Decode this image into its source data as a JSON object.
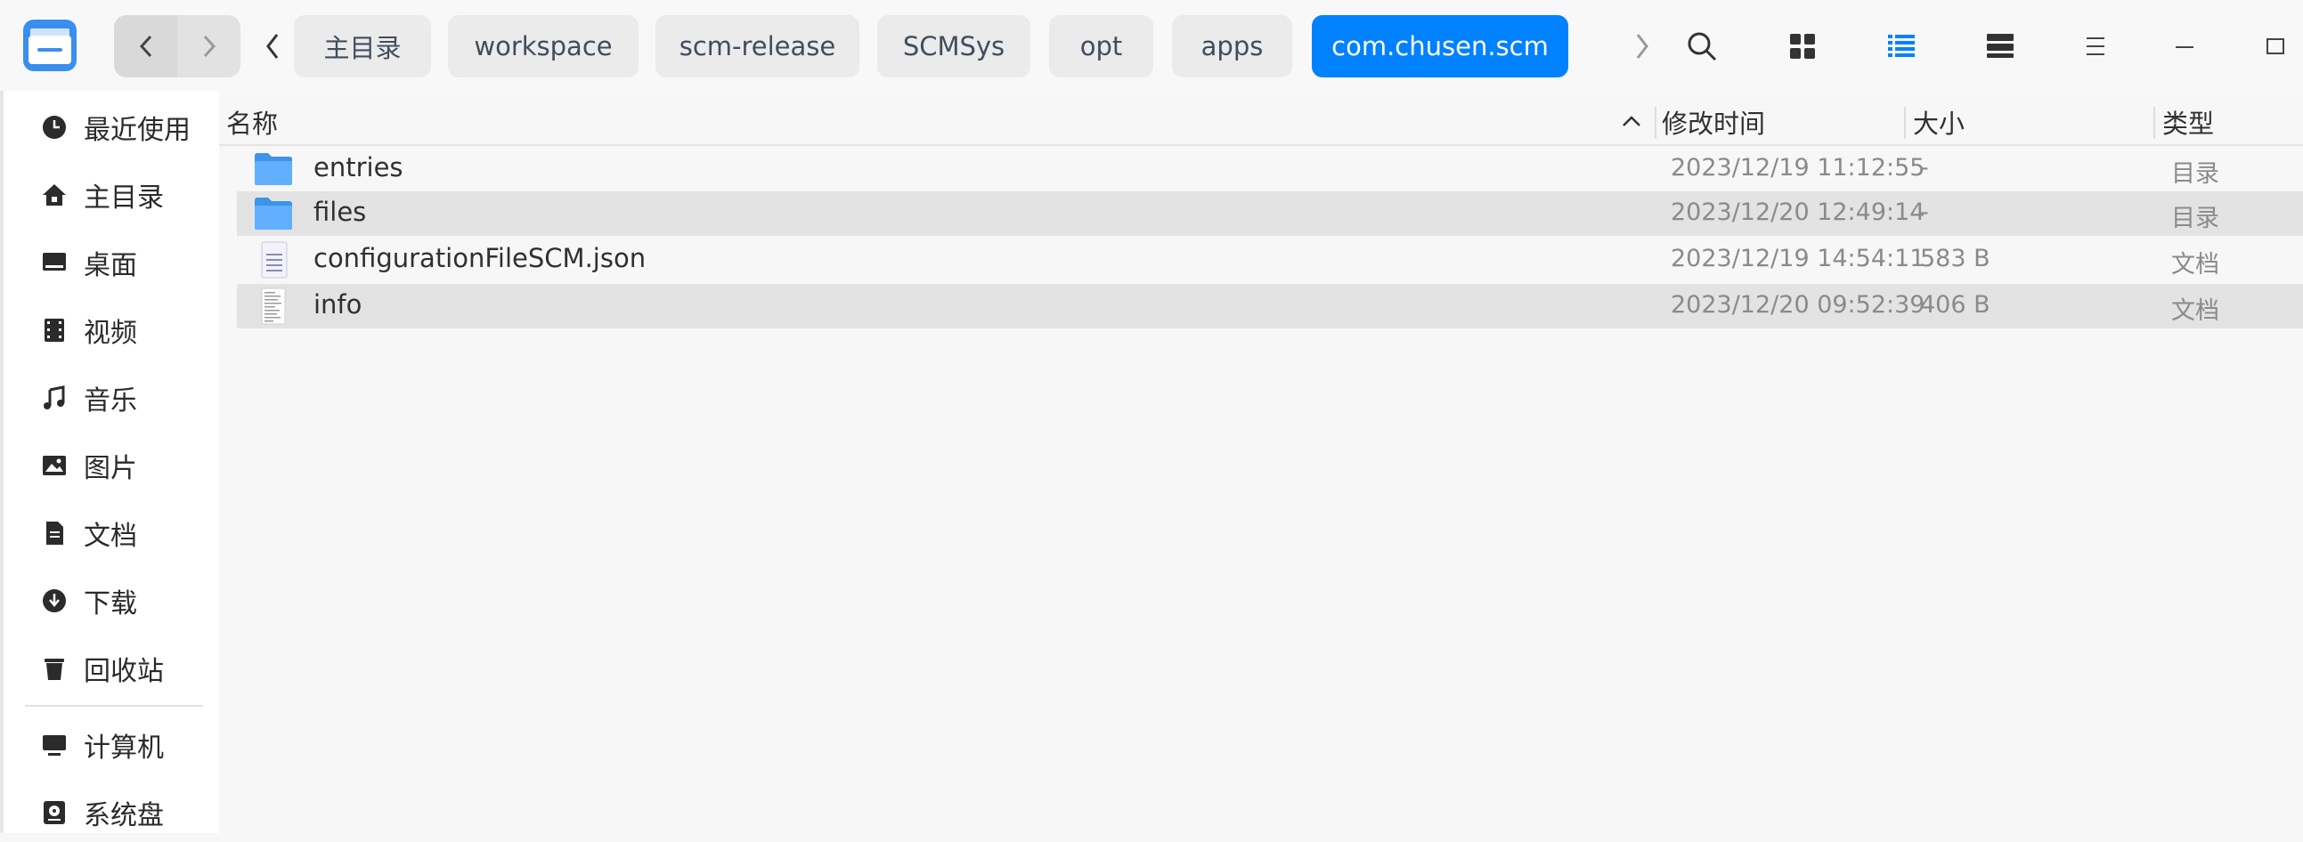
{
  "toolbar": {
    "breadcrumbs": [
      {
        "label": "主目录",
        "active": false
      },
      {
        "label": "workspace",
        "active": false
      },
      {
        "label": "scm-release",
        "active": false
      },
      {
        "label": "SCMSys",
        "active": false
      },
      {
        "label": "opt",
        "active": false
      },
      {
        "label": "apps",
        "active": false
      },
      {
        "label": "com.chusen.scm",
        "active": true
      }
    ],
    "icons": [
      "search-icon",
      "icon-view-icon",
      "list-view-icon",
      "detail-view-icon",
      "menu-icon",
      "minimize-icon",
      "maximize-icon"
    ]
  },
  "sidebar": {
    "items": [
      {
        "label": "最近使用",
        "icon": "recent-icon"
      },
      {
        "label": "主目录",
        "icon": "home-icon"
      },
      {
        "label": "桌面",
        "icon": "desktop-icon"
      },
      {
        "label": "视频",
        "icon": "video-icon"
      },
      {
        "label": "音乐",
        "icon": "music-icon"
      },
      {
        "label": "图片",
        "icon": "picture-icon"
      },
      {
        "label": "文档",
        "icon": "document-icon"
      },
      {
        "label": "下载",
        "icon": "download-icon"
      },
      {
        "label": "回收站",
        "icon": "trash-icon"
      },
      {
        "label": "计算机",
        "icon": "computer-icon"
      },
      {
        "label": "系统盘",
        "icon": "disk-icon"
      }
    ]
  },
  "table": {
    "headers": {
      "name": "名称",
      "modified": "修改时间",
      "size": "大小",
      "type": "类型"
    },
    "rows": [
      {
        "name": "entries",
        "modified": "2023/12/19 11:12:55",
        "size": "-",
        "type": "目录",
        "icon": "folder-icon"
      },
      {
        "name": "files",
        "modified": "2023/12/20 12:49:14",
        "size": "-",
        "type": "目录",
        "icon": "folder-icon"
      },
      {
        "name": "configurationFileSCM.json",
        "modified": "2023/12/19 14:54:11",
        "size": "583 B",
        "type": "文档",
        "icon": "json-file-icon"
      },
      {
        "name": "info",
        "modified": "2023/12/20 09:52:39",
        "size": "406 B",
        "type": "文档",
        "icon": "text-file-icon"
      }
    ]
  },
  "colors": {
    "accent": "#0081ff",
    "row_alt": "#e3e3e3",
    "sidebar_bg": "#ffffff"
  }
}
